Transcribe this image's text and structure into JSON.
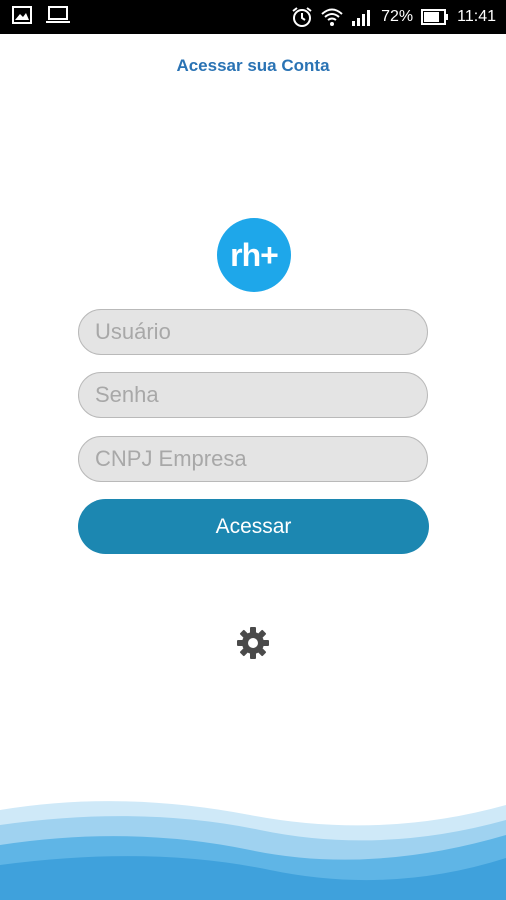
{
  "status": {
    "battery": "72%",
    "time": "11:41"
  },
  "header": {
    "title": "Acessar sua Conta"
  },
  "logo": {
    "text": "rh+"
  },
  "form": {
    "user_placeholder": "Usuário",
    "password_placeholder": "Senha",
    "cnpj_placeholder": "CNPJ Empresa",
    "submit_label": "Acessar"
  },
  "colors": {
    "accent": "#2a73b4",
    "logo_bg": "#1ea7ea",
    "button_bg": "#1c87b1"
  },
  "icons": [
    "image-icon",
    "laptop-icon",
    "alarm-icon",
    "wifi-icon",
    "signal-icon",
    "battery-icon",
    "gear-icon"
  ]
}
